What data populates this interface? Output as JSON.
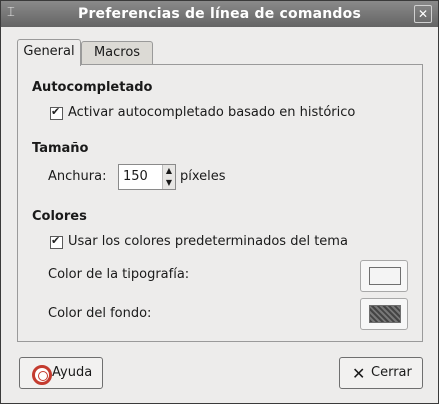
{
  "window": {
    "title": "Preferencias de línea de comandos"
  },
  "tabs": [
    {
      "label": "General",
      "active": true
    },
    {
      "label": "Macros",
      "active": false
    }
  ],
  "sections": {
    "autocomplete": {
      "title": "Autocompletado",
      "checkbox_label": "Activar autocompletado basado en histórico",
      "checked": true
    },
    "size": {
      "title": "Tamaño",
      "width_label": "Anchura:",
      "width_value": "150",
      "unit": "píxeles"
    },
    "colors": {
      "title": "Colores",
      "checkbox_label": "Usar los colores predeterminados del tema",
      "checked": true,
      "font_color_label": "Color de la tipografía:",
      "background_color_label": "Color del fondo:",
      "font_color_value": "#f4f4f4",
      "background_color_value": "#555555"
    }
  },
  "buttons": {
    "help": "Ayuda",
    "close": "Cerrar"
  },
  "icons": {
    "window_menu": "window-menu-icon",
    "window_close": "close-icon",
    "help": "help-lifebuoy-icon",
    "close": "x-icon",
    "spin_up": "spin-up-icon",
    "spin_down": "spin-down-icon"
  }
}
